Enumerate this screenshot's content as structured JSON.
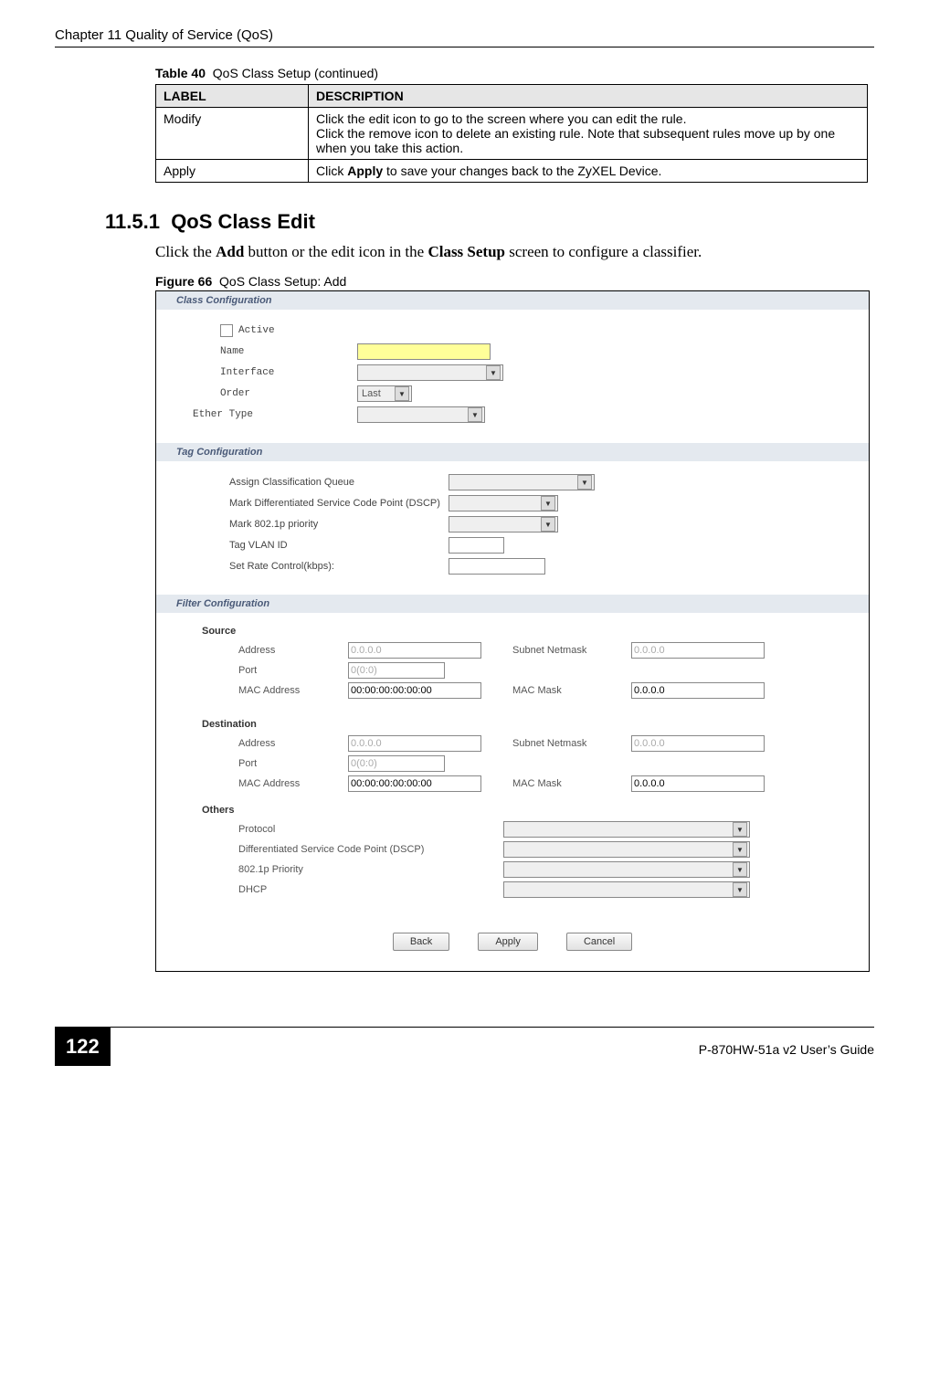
{
  "header": {
    "chapter": "Chapter 11 Quality of Service (QoS)"
  },
  "table40": {
    "caption_prefix": "Table 40",
    "caption_rest": "QoS Class Setup (continued)",
    "head_label": "LABEL",
    "head_desc": "DESCRIPTION",
    "rows": [
      {
        "label": "Modify",
        "desc1": "Click the edit icon to go to the screen where you can edit the rule.",
        "desc2": "Click the remove icon to delete an existing rule. Note that subsequent rules move up by one when you take this action."
      },
      {
        "label": "Apply",
        "desc": "Click Apply to save your changes back to the ZyXEL Device."
      }
    ]
  },
  "section": {
    "num": "11.5.1",
    "title": "QoS Class Edit",
    "body_pre": "Click the ",
    "body_bold1": "Add",
    "body_mid": " button or the edit icon in the ",
    "body_bold2": "Class Setup",
    "body_post": " screen to configure a classifier."
  },
  "figure": {
    "caption_prefix": "Figure 66",
    "caption_rest": "QoS Class Setup: Add"
  },
  "screenshot": {
    "class_config": {
      "title": "Class Configuration",
      "active": "Active",
      "name": "Name",
      "interface": "Interface",
      "order": "Order",
      "order_val": "Last",
      "ether_type": "Ether Type"
    },
    "tag_config": {
      "title": "Tag Configuration",
      "assign_q": "Assign Classification Queue",
      "dscp": "Mark Differentiated Service Code Point (DSCP)",
      "mark_8021p": "Mark 802.1p priority",
      "tag_vlan": "Tag VLAN ID",
      "rate": "Set Rate Control(kbps):"
    },
    "filter_config": {
      "title": "Filter Configuration",
      "source": "Source",
      "destination": "Destination",
      "others": "Others",
      "address": "Address",
      "subnet": "Subnet Netmask",
      "port": "Port",
      "mac": "MAC Address",
      "mac_mask": "MAC Mask",
      "addr_val": "0.0.0.0",
      "port_val": "0(0:0)",
      "mac_val": "00:00:00:00:00:00",
      "mask_val": "0.0.0.0",
      "protocol": "Protocol",
      "dscp": "Differentiated Service Code Point (DSCP)",
      "p8021": "802.1p Priority",
      "dhcp": "DHCP"
    },
    "buttons": {
      "back": "Back",
      "apply": "Apply",
      "cancel": "Cancel"
    }
  },
  "footer": {
    "page": "122",
    "guide": "P-870HW-51a v2 User’s Guide"
  }
}
